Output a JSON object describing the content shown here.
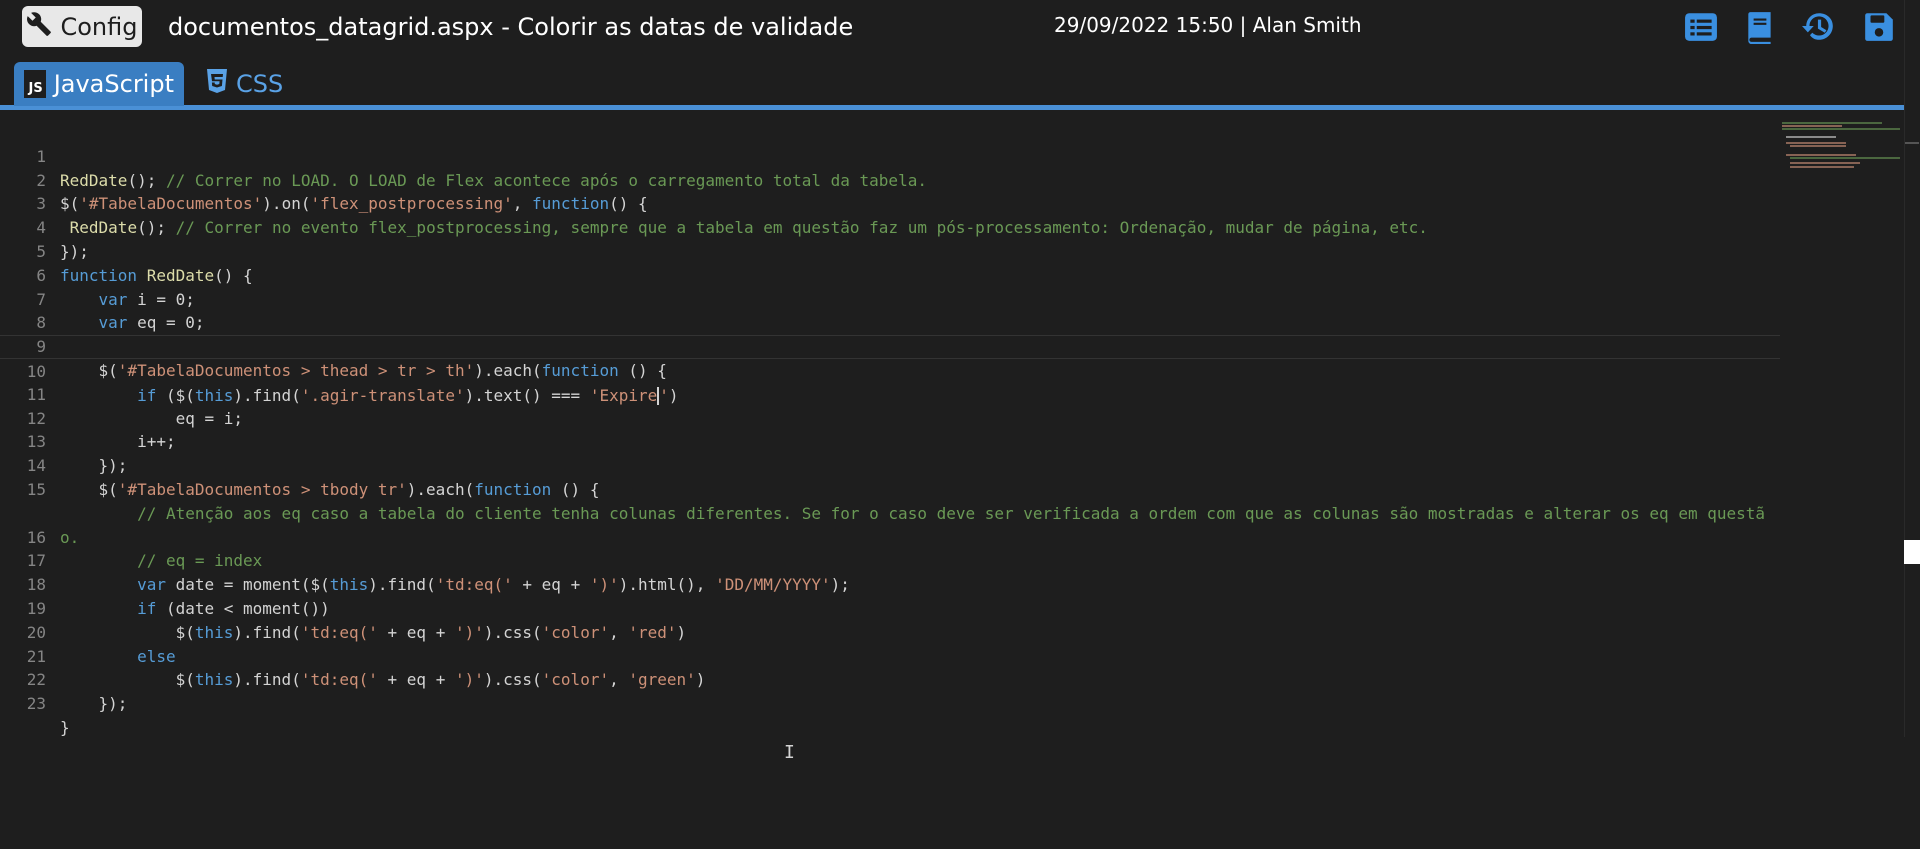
{
  "header": {
    "config_label": "Config",
    "title": "documentos_datagrid.aspx - Colorir as datas de validade",
    "datetime_user": "29/09/2022 15:50 | Alan Smith",
    "icons": [
      "list-icon",
      "book-icon",
      "history-icon",
      "save-icon"
    ]
  },
  "tabs": [
    {
      "label": "JavaScript",
      "badge": "JS",
      "active": true
    },
    {
      "label": "CSS",
      "active": false
    }
  ],
  "editor": {
    "line_numbers": [
      "1",
      "2",
      "3",
      "4",
      "5",
      "6",
      "7",
      "8",
      "9",
      "10",
      "11",
      "12",
      "13",
      "14",
      "15",
      "16",
      "17",
      "18",
      "19",
      "20",
      "21",
      "22",
      "23"
    ],
    "accent_color": "#4a90d6"
  }
}
